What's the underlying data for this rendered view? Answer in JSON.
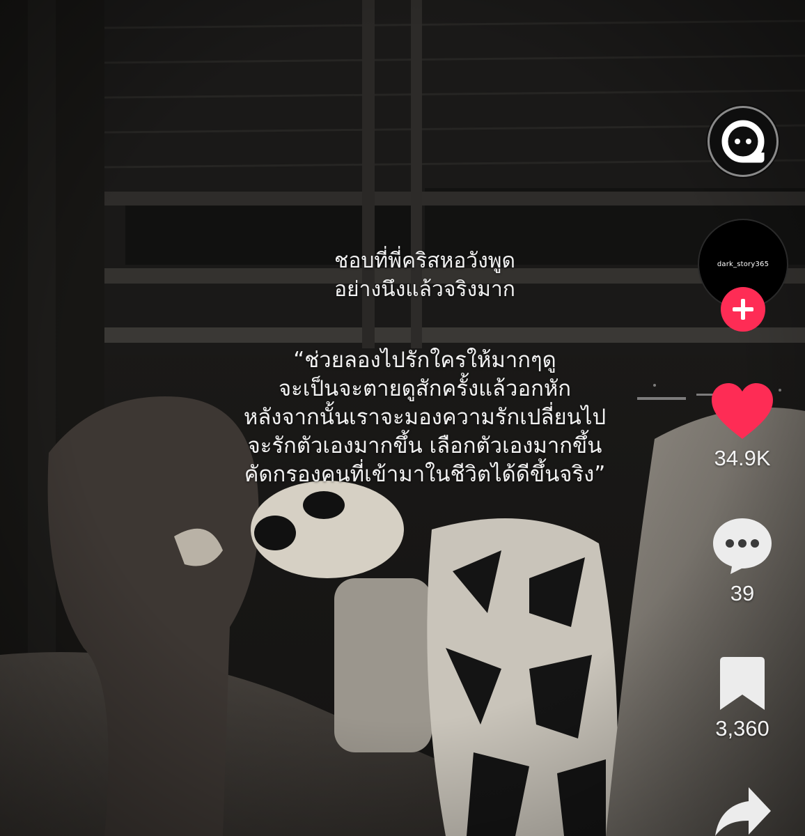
{
  "caption": {
    "top_lines": [
      "ชอบที่พี่คริสหอวังพูด",
      "อย่างนึงแล้วจริงมาก"
    ],
    "quote_lines": [
      "“ช่วยลองไปรักใครให้มากๆดู",
      "จะเป็นจะตายดูสักครั้งแล้วอกหัก",
      "หลังจากนั้นเราจะมองความรักเปลี่ยนไป",
      "จะรักตัวเองมากขึ้น เลือกตัวเองมากขึ้น",
      "คัดกรองคนที่เข้ามาในชีวิตได้ดีขึ้นจริง”"
    ]
  },
  "profile": {
    "username": "dark_story365"
  },
  "actions": {
    "likes": "34.9K",
    "comments": "39",
    "saves": "3,360"
  },
  "icons": {
    "ai_chat": "ai-chat-icon",
    "follow": "plus-icon",
    "like": "heart-icon",
    "comment": "comment-bubble-icon",
    "save": "bookmark-icon",
    "share": "share-arrow-icon"
  },
  "colors": {
    "like_red": "#fe2c55",
    "follow_red": "#fe2c55",
    "text": "#f2f2f2"
  }
}
